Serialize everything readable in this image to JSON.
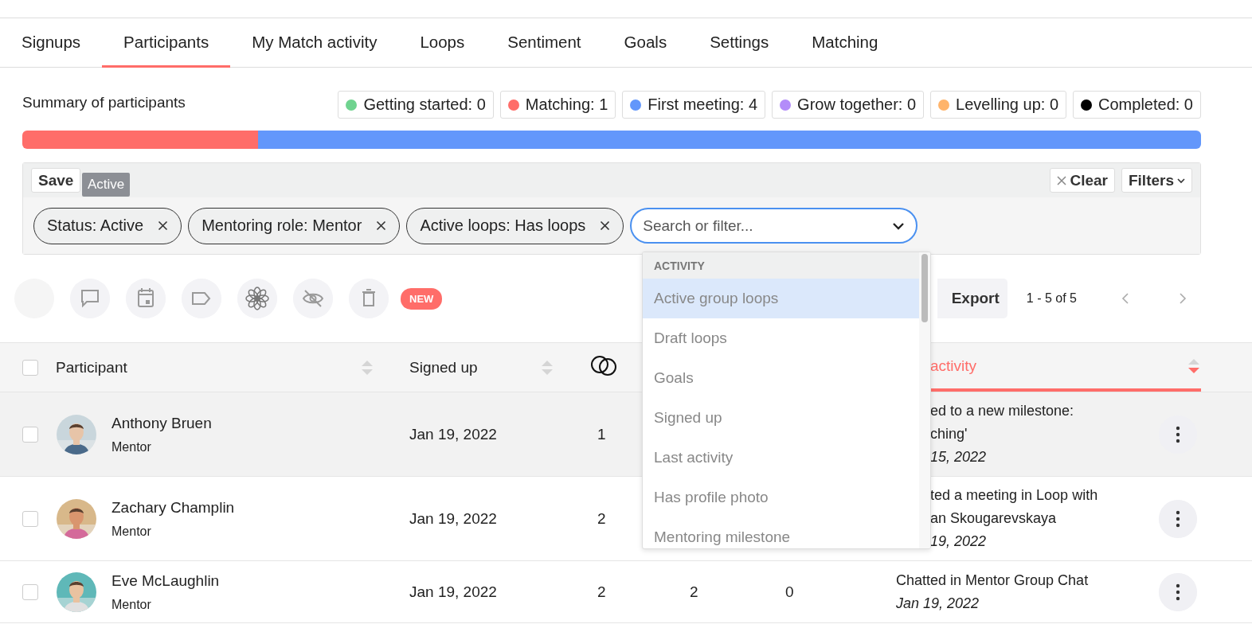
{
  "tabs": [
    {
      "label": "Signups",
      "selected": false
    },
    {
      "label": "Participants",
      "selected": true
    },
    {
      "label": "My Match activity",
      "selected": false
    },
    {
      "label": "Loops",
      "selected": false
    },
    {
      "label": "Sentiment",
      "selected": false
    },
    {
      "label": "Goals",
      "selected": false
    },
    {
      "label": "Settings",
      "selected": false
    },
    {
      "label": "Matching",
      "selected": false
    }
  ],
  "summary": {
    "title": "Summary of participants",
    "stages": [
      {
        "label": "Getting started: 0",
        "color": "#6fd38f"
      },
      {
        "label": "Matching: 1",
        "color": "#ff6d69"
      },
      {
        "label": "First meeting: 4",
        "color": "#6397fb"
      },
      {
        "label": "Grow together: 0",
        "color": "#b38cf9"
      },
      {
        "label": "Levelling up: 0",
        "color": "#ffb46b"
      },
      {
        "label": "Completed: 0",
        "color": "#000000"
      }
    ],
    "bar": [
      {
        "color": "#ff6d69",
        "level": 0.2
      },
      {
        "color": "#6397fb",
        "level": 0.8
      }
    ]
  },
  "filters": {
    "save": "Save",
    "tooltip": "Active",
    "clear": "Clear",
    "filters_button": "Filters",
    "chips": [
      {
        "label": "Status: Active"
      },
      {
        "label": "Mentoring role: Mentor"
      },
      {
        "label": "Active loops: Has loops"
      }
    ],
    "search": {
      "placeholder": "Search or filter..."
    },
    "dropdown": {
      "group": "ACTIVITY",
      "items": [
        {
          "label": "Active group loops",
          "selected": true
        },
        {
          "label": "Draft loops",
          "selected": false
        },
        {
          "label": "Goals",
          "selected": false
        },
        {
          "label": "Signed up",
          "selected": false
        },
        {
          "label": "Last activity",
          "selected": false
        },
        {
          "label": "Has profile photo",
          "selected": false
        },
        {
          "label": "Mentoring milestone",
          "selected": false
        }
      ]
    }
  },
  "toolbar": {
    "badge": "NEW",
    "export": "Export",
    "pagination": "1 - 5 of 5"
  },
  "table": {
    "select_all_checked": false,
    "columns": [
      {
        "kind": "text",
        "label": "Participant",
        "sorted": false
      },
      {
        "kind": "text",
        "label": "Signed up",
        "sorted": false
      },
      {
        "kind": "loops-icon"
      },
      {
        "kind": "text",
        "label": "activity",
        "sorted": true,
        "cut": true
      }
    ],
    "rows": [
      {
        "checked": false,
        "highlighted": true,
        "name": "Anthony Bruen",
        "role": "Mentor",
        "signed_up": "Jan 19, 2022",
        "column_3": "1",
        "activity": "ed to a new milestone:",
        "activity_2": "ching'",
        "date": "15, 2022",
        "cut": true
      },
      {
        "checked": false,
        "highlighted": false,
        "name": "Zachary Champlin",
        "role": "Mentor",
        "signed_up": "Jan 19, 2022",
        "column_3": "2",
        "activity": "ted a meeting in Loop with",
        "activity_2": "an Skougarevskaya",
        "date": "19, 2022",
        "cut": true
      },
      {
        "checked": false,
        "highlighted": false,
        "name": "Eve McLaughlin",
        "role": "Mentor",
        "signed_up": "Jan 19, 2022",
        "column_3": "2",
        "column_4": "2",
        "column_5": "0",
        "activity": "Chatted in Mentor Group Chat",
        "date": "Jan 19, 2022",
        "cut": false
      }
    ]
  }
}
